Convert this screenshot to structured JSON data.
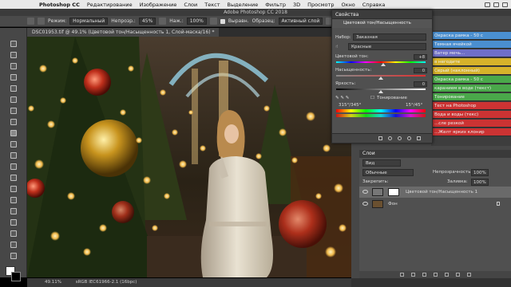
{
  "menubar": {
    "items": [
      "Photoshop CC",
      "Редактирование",
      "Изображение",
      "Слои",
      "Текст",
      "Выделение",
      "Фильтр",
      "3D",
      "Просмотр",
      "Окно",
      "Справка"
    ]
  },
  "app_title": "Adobe Photoshop CC 2018",
  "options_bar": {
    "mode_label": "Режим:",
    "mode_value": "Нормальный",
    "opacity_label": "Непрозр.:",
    "opacity_value": "45%",
    "flow_label": "Наж.:",
    "flow_value": "100%",
    "sample_label": "Образец:",
    "sample_value": "Активный слой",
    "align_label": "Выравн."
  },
  "document": {
    "tab_label": "DSC01953.tif @ 49.1% (Цветовой тон/Насыщенность 1, Слой-маска/16) *"
  },
  "status": {
    "zoom": "49.11%",
    "info": "sRGB IEC61966-2.1 (16bpc)"
  },
  "properties": {
    "panel_title": "Свойства",
    "adjustment_name": "Цветовой тон/Насыщенность",
    "preset_label": "Набор:",
    "preset_value": "Заказная",
    "channel_value": "Красные",
    "hue_label": "Цветовой тон:",
    "hue_value": "+8",
    "saturation_label": "Насыщенность:",
    "saturation_value": "0",
    "lightness_label": "Яркость:",
    "lightness_value": "0",
    "colorize_label": "Тонирование",
    "range_left": "315°/345°",
    "range_right": "15°/45°"
  },
  "adjustment_list": [
    {
      "label": "Окраска рамка - 50 с",
      "color": "#4a8fd0"
    },
    {
      "label": "Темная ячейкой",
      "color": "#4a8fd0"
    },
    {
      "label": "Ватер мечь...",
      "color": "#6f6fc8"
    },
    {
      "label": "в негодите",
      "color": "#d6b22a"
    },
    {
      "label": "Серый (наклонный)",
      "color": "#d6b22a"
    },
    {
      "label": "Окраска рамка - 50 с",
      "color": "#4aa84a"
    },
    {
      "label": "каранием в воде (текст)",
      "color": "#4aa84a"
    },
    {
      "label": "Тонирование",
      "color": "#4aa84a"
    },
    {
      "label": "Тест на Photoshop",
      "color": "#c33"
    },
    {
      "label": "Вода и воды (текс)",
      "color": "#c33"
    },
    {
      "label": "...сле резкой",
      "color": "#c33"
    },
    {
      "label": "...Желт ярких клонир",
      "color": "#c33"
    }
  ],
  "layers": {
    "panel_title": "Слои",
    "filter_value": "Вид",
    "blend_value": "Обычные",
    "opacity_label": "Непрозрачность:",
    "opacity_value": "100%",
    "lock_label": "Закрепить:",
    "fill_label": "Заливка:",
    "fill_value": "100%",
    "items": [
      {
        "name": "Цветовой тон/Насыщенность 1",
        "selected": true
      },
      {
        "name": "Фон",
        "selected": false
      }
    ]
  }
}
